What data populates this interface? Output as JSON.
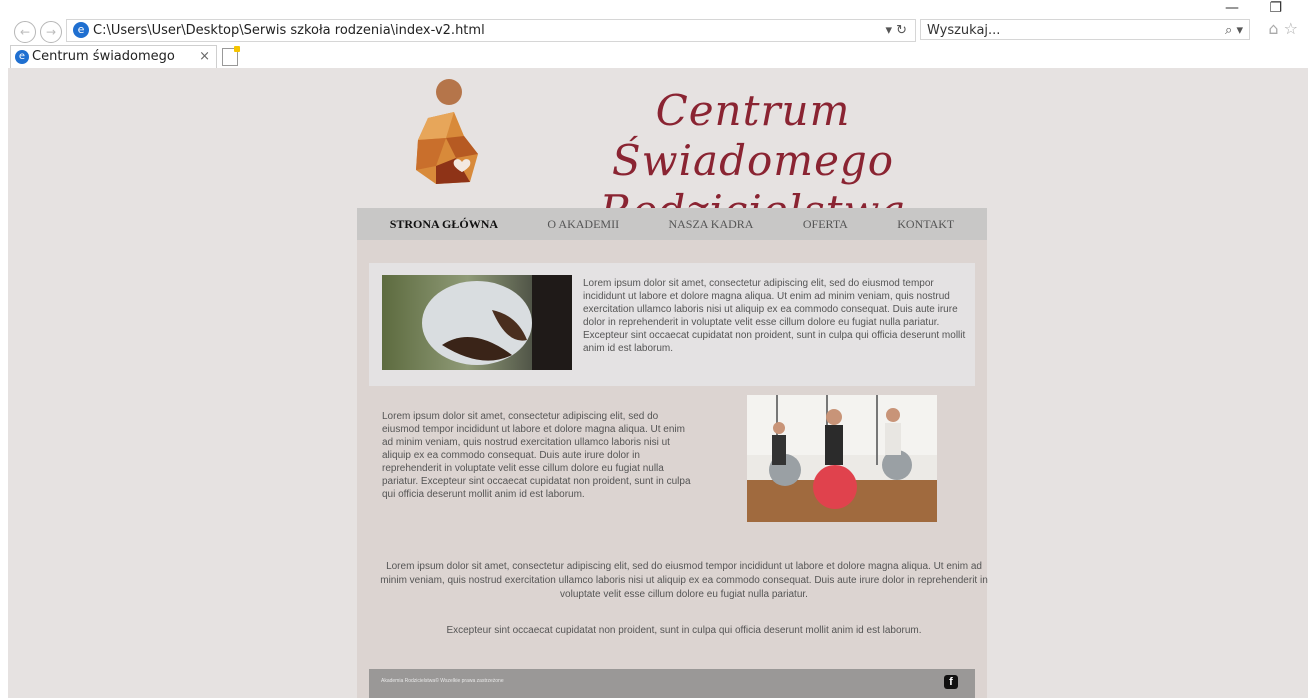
{
  "browser": {
    "address": "C:\\Users\\User\\Desktop\\Serwis szkoła rodzenia\\index-v2.html",
    "search_placeholder": "Wyszukaj...",
    "tab_title": "Centrum świadomego rodzic...",
    "tab_close": "×",
    "minimize": "—",
    "restore": "❐"
  },
  "site": {
    "title_line1": "Centrum Świadomego",
    "title_line2": "Rodzicielstwa",
    "brand_color": "#8a2432"
  },
  "menu": {
    "items": [
      {
        "label": "STRONA GŁÓWNA"
      },
      {
        "label": "O AKADEMII"
      },
      {
        "label": "NASZA KADRA"
      },
      {
        "label": "OFERTA"
      },
      {
        "label": "KONTAKT"
      }
    ]
  },
  "content": {
    "para1": "Lorem ipsum dolor sit amet, consectetur adipiscing elit, sed do eiusmod tempor incididunt ut labore et dolore magna aliqua. Ut enim ad minim veniam, quis nostrud exercitation ullamco laboris nisi ut aliquip ex ea commodo consequat. Duis aute irure dolor in reprehenderit in voluptate velit esse cillum dolore eu fugiat nulla pariatur. Excepteur sint occaecat cupidatat non proident, sunt in culpa qui officia deserunt mollit anim id est laborum.",
    "para2": "Lorem ipsum dolor sit amet, consectetur adipiscing elit, sed do eiusmod tempor incididunt ut labore et dolore magna aliqua. Ut enim ad minim veniam, quis nostrud exercitation ullamco laboris nisi ut aliquip ex ea commodo consequat. Duis aute irure dolor in reprehenderit in voluptate velit esse cillum dolore eu fugiat nulla pariatur. Excepteur sint occaecat cupidatat non proident, sunt in culpa qui officia deserunt mollit anim id est laborum.",
    "para3": "Lorem ipsum dolor sit amet, consectetur adipiscing elit, sed do eiusmod tempor incididunt ut labore et dolore magna aliqua. Ut enim ad minim veniam, quis nostrud exercitation ullamco laboris nisi ut aliquip ex ea commodo consequat. Duis aute irure dolor in reprehenderit in voluptate velit esse cillum dolore eu fugiat nulla pariatur.",
    "para4": "Excepteur sint occaecat cupidatat non proident, sunt in culpa qui officia deserunt mollit anim id est laborum."
  },
  "footer": {
    "copyright": "Akademia Rodzicielstwa© Wszelkie prawa zastrzeżone",
    "facebook_icon": "f"
  }
}
